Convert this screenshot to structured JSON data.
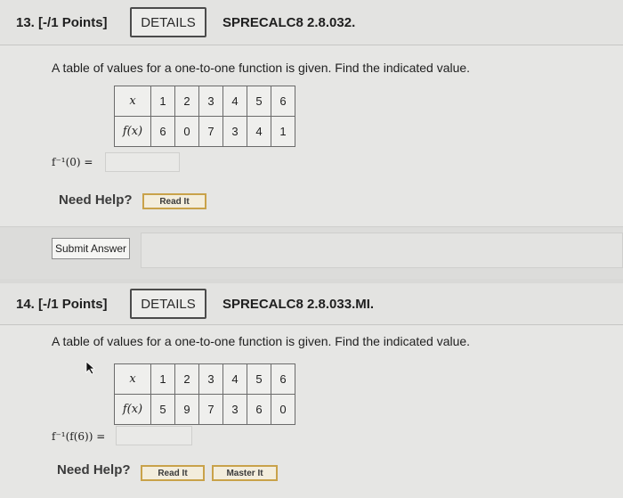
{
  "questions": [
    {
      "number": "13.",
      "points": "[-/1 Points]",
      "details_label": "DETAILS",
      "code": "SPRECALC8 2.8.032.",
      "prompt": "A table of values for a one-to-one function is given. Find the indicated value.",
      "table": {
        "x_label": "x",
        "fx_label": "f(x)",
        "x": [
          "1",
          "2",
          "3",
          "4",
          "5",
          "6"
        ],
        "fx": [
          "6",
          "0",
          "7",
          "3",
          "4",
          "1"
        ]
      },
      "answer_label": "f⁻¹(0) =",
      "answer_value": "",
      "need_help": "Need Help?",
      "help_buttons": [
        "Read It"
      ],
      "submit_label": "Submit Answer"
    },
    {
      "number": "14.",
      "points": "[-/1 Points]",
      "details_label": "DETAILS",
      "code": "SPRECALC8 2.8.033.MI.",
      "prompt": "A table of values for a one-to-one function is given. Find the indicated value.",
      "table": {
        "x_label": "x",
        "fx_label": "f(x)",
        "x": [
          "1",
          "2",
          "3",
          "4",
          "5",
          "6"
        ],
        "fx": [
          "5",
          "9",
          "7",
          "3",
          "6",
          "0"
        ]
      },
      "answer_label": "f⁻¹(f(6)) =",
      "answer_value": "",
      "need_help": "Need Help?",
      "help_buttons": [
        "Read It",
        "Master It"
      ]
    }
  ],
  "colors": {
    "background": "#d9d9d7",
    "help_button_border": "#c9a24a"
  }
}
